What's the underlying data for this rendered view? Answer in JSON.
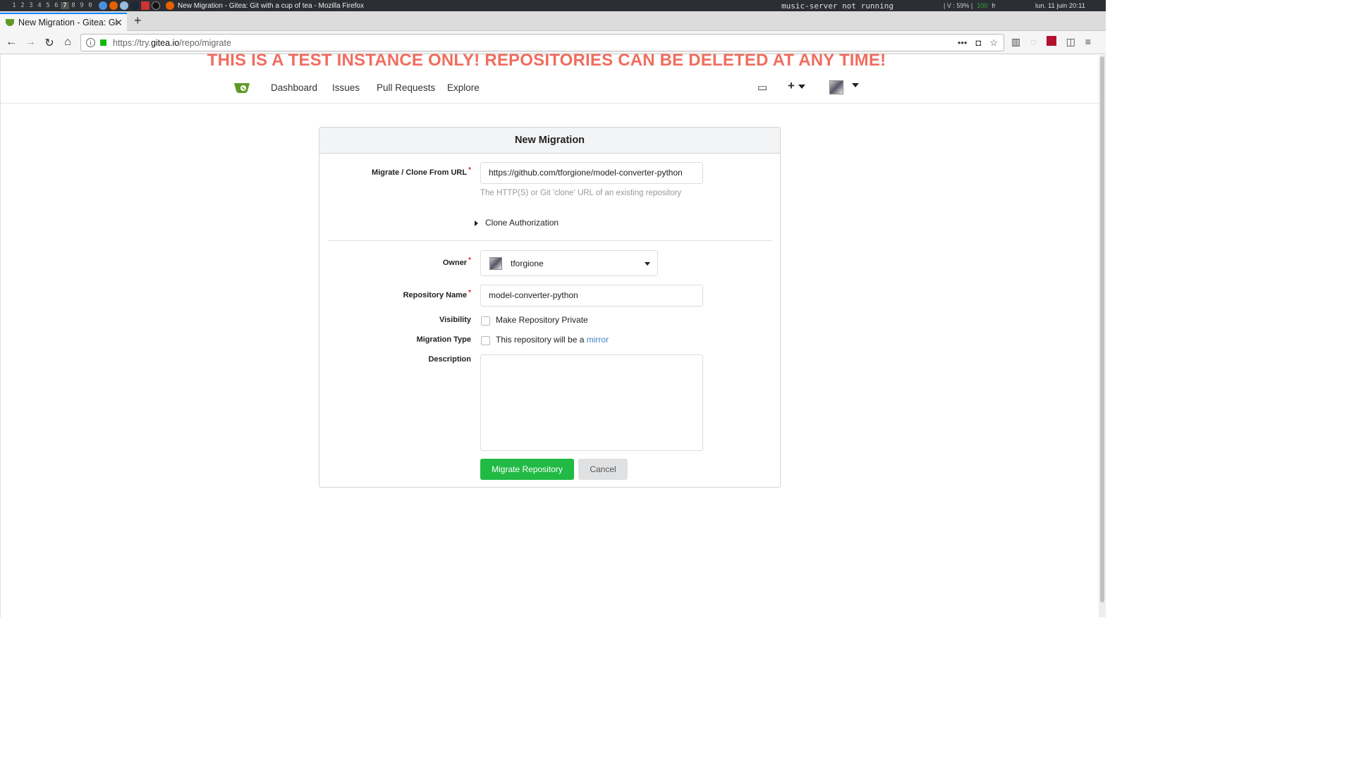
{
  "system_bar": {
    "workspaces": [
      "1",
      "2",
      "3",
      "4",
      "5",
      "6",
      "7",
      "8",
      "9",
      "0"
    ],
    "window_title": "New Migration - Gitea: Git with a cup of tea - Mozilla Firefox",
    "music_status": "music-server  not running",
    "stats": "| V : 59% |",
    "stats_green": "100",
    "lang": "fr",
    "clock": "lun. 11 juin  20:11"
  },
  "browser": {
    "tab_title": "New Migration - Gitea: Git",
    "url_prefix": "https://try.",
    "url_domain": "gitea.io",
    "url_path": "/repo/migrate"
  },
  "banner": "THIS IS A TEST INSTANCE ONLY! REPOSITORIES CAN BE DELETED AT ANY TIME!",
  "nav": {
    "items": [
      "Dashboard",
      "Issues",
      "Pull Requests",
      "Explore"
    ],
    "plus": "+"
  },
  "form": {
    "title": "New Migration",
    "clone_url_label": "Migrate / Clone From URL",
    "clone_url_value": "https://github.com/tforgione/model-converter-python",
    "clone_url_help": "The HTTP(S) or Git 'clone' URL of an existing repository",
    "clone_auth": "Clone Authorization",
    "owner_label": "Owner",
    "owner_value": "tforgione",
    "repo_name_label": "Repository Name",
    "repo_name_value": "model-converter-python",
    "visibility_label": "Visibility",
    "visibility_text": "Make Repository Private",
    "migration_type_label": "Migration Type",
    "migration_type_text": "This repository will be a",
    "mirror_link": "mirror",
    "description_label": "Description",
    "submit": "Migrate Repository",
    "cancel": "Cancel"
  }
}
